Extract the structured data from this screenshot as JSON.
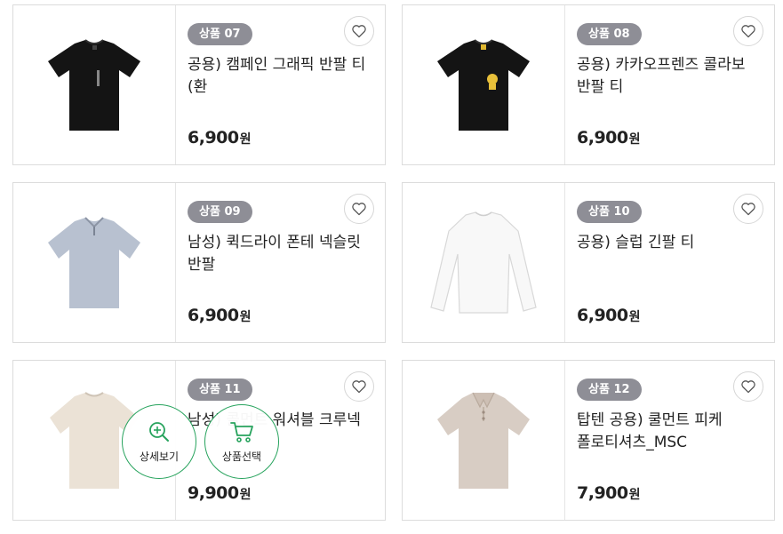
{
  "products": [
    {
      "badge": "상품 07",
      "name": "공용) 캠페인 그래픽 반팔 티(환",
      "price": "6,900",
      "unit": "원",
      "shirt": "black-tee",
      "shirt_color": "#111111"
    },
    {
      "badge": "상품 08",
      "name": "공용) 카카오프렌즈 콜라보 반팔 티",
      "price": "6,900",
      "unit": "원",
      "shirt": "black-tee-yellow",
      "shirt_color": "#111111"
    },
    {
      "badge": "상품 09",
      "name": "남성) 퀵드라이 폰테 넥슬릿 반팔",
      "price": "6,900",
      "unit": "원",
      "shirt": "grey-slit-tee",
      "shirt_color": "#b7c0cf"
    },
    {
      "badge": "상품 10",
      "name": "공용) 슬럽 긴팔 티",
      "price": "6,900",
      "unit": "원",
      "shirt": "white-longsleeve",
      "shirt_color": "#f7f7f7"
    },
    {
      "badge": "상품 11",
      "name": "남성) 콜먼트 워셔블 크루넥",
      "price": "9,900",
      "unit": "원",
      "shirt": "beige-tee",
      "shirt_color": "#e9e0d3"
    },
    {
      "badge": "상품 12",
      "name": "탑텐 공용) 쿨먼트 피케 폴로티셔츠_MSC",
      "price": "7,900",
      "unit": "원",
      "shirt": "beige-polo",
      "shirt_color": "#d8ccc3"
    }
  ],
  "overlay": {
    "detail_label": "상세보기",
    "select_label": "상품선택"
  },
  "colors": {
    "badge_bg": "#8e8e96",
    "accent_green": "#27a35d",
    "border": "#dcdcdc"
  },
  "icons": {
    "wishlist": "heart-icon",
    "zoom": "zoom-plus-icon",
    "cart": "cart-icon"
  }
}
